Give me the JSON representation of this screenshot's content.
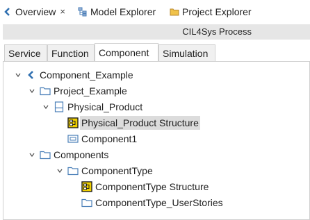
{
  "view_tabs": {
    "overview": "Overview",
    "model_explorer": "Model Explorer",
    "project_explorer": "Project Explorer",
    "close_glyph": "×"
  },
  "process_title": "CIL4Sys Process",
  "sub_tabs": [
    "Service",
    "Function",
    "Component",
    "Simulation"
  ],
  "tree": {
    "root": "Component_Example",
    "project": "Project_Example",
    "physical_product": "Physical_Product",
    "physical_product_structure": "Physical_Product Structure",
    "component1": "Component1",
    "components": "Components",
    "component_type": "ComponentType",
    "component_type_structure": "ComponentType Structure",
    "component_type_user_stories": "ComponentType_UserStories"
  },
  "colors": {
    "accent_blue": "#2f6fb0",
    "folder_blue": "#4a7fb8",
    "structure_yellow": "#f0d000",
    "selected_bg": "#dcdcdc"
  },
  "icons": {
    "overview": "back-chevron-icon",
    "model_explorer": "tree-icon",
    "project_explorer": "folder-icon"
  }
}
